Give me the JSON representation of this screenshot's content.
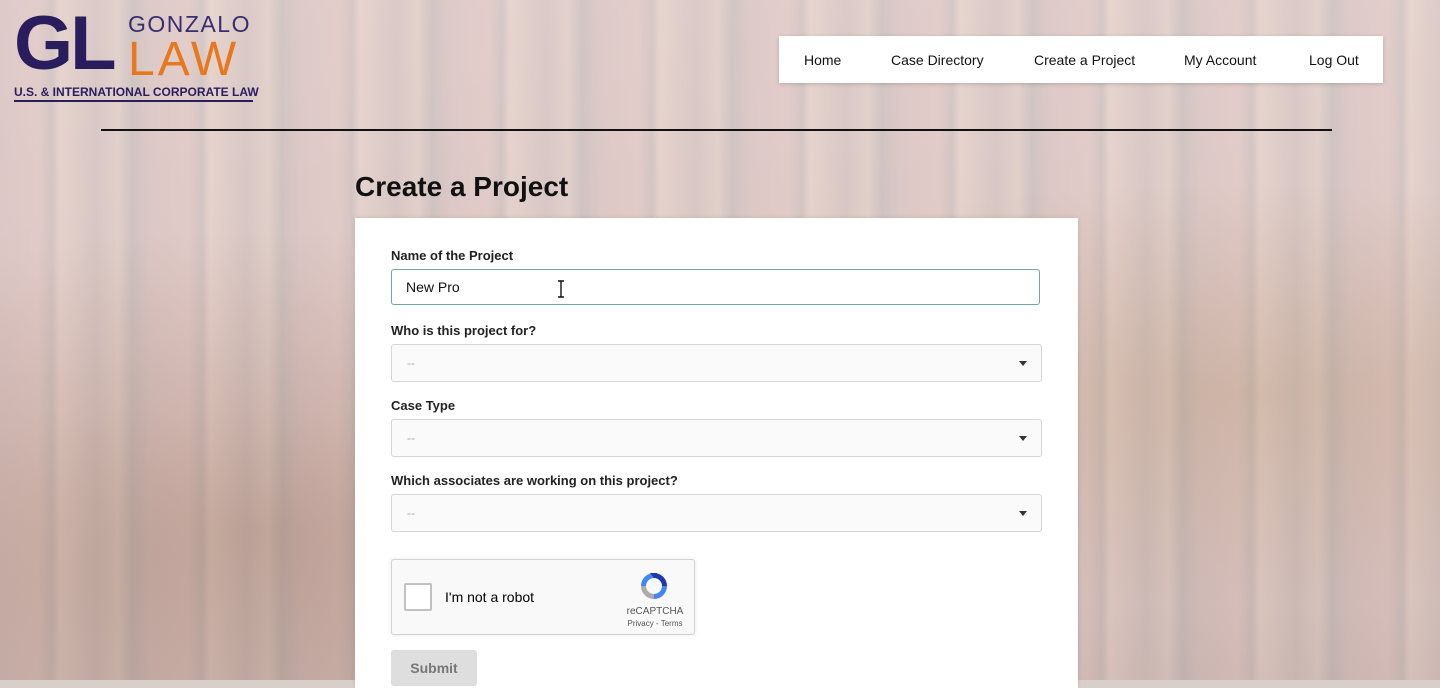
{
  "logo": {
    "initials": "GL",
    "name_top": "GONZALO",
    "name_bottom": "LAW",
    "tagline": "U.S. & INTERNATIONAL CORPORATE LAW"
  },
  "nav": {
    "items": [
      {
        "label": "Home"
      },
      {
        "label": "Case Directory"
      },
      {
        "label": "Create a Project"
      },
      {
        "label": "My Account"
      },
      {
        "label": "Log Out"
      }
    ]
  },
  "page_title": "Create a Project",
  "form": {
    "project_name": {
      "label": "Name of the Project",
      "value": "New Pro"
    },
    "client": {
      "label": "Who is this project for?",
      "value": "--"
    },
    "case_type": {
      "label": "Case Type",
      "value": "--"
    },
    "associates": {
      "label": "Which associates are working on this project?",
      "value": "--"
    },
    "captcha": {
      "label": "I'm not a robot",
      "brand": "reCAPTCHA",
      "links": "Privacy - Terms"
    },
    "submit_label": "Submit"
  },
  "colors": {
    "brand_navy": "#2a1d5e",
    "brand_orange": "#e8781e",
    "focus_border": "#6fa6a8"
  }
}
